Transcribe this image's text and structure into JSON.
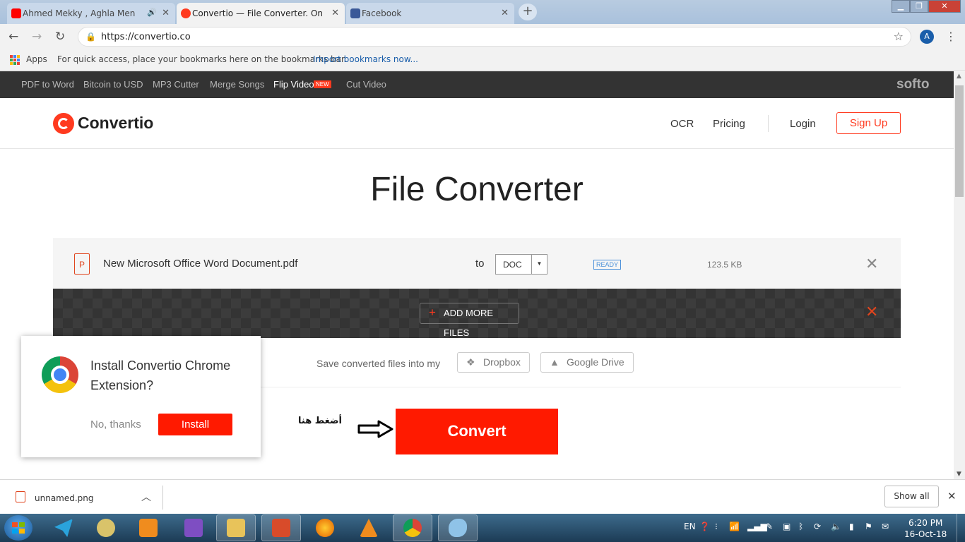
{
  "browser": {
    "tabs": [
      {
        "title": "Ahmed Mekky , Aghla Men A",
        "favicon": "youtube-icon",
        "color": "#ff0000",
        "audio": true,
        "active": false
      },
      {
        "title": "Convertio — File Converter. Onli",
        "favicon": "convertio-icon",
        "color": "#ff3a1f",
        "audio": false,
        "active": true
      },
      {
        "title": "Facebook",
        "favicon": "facebook-icon",
        "color": "#3b5998",
        "audio": false,
        "active": false
      }
    ],
    "url": "https://convertio.co",
    "avatar_letter": "A",
    "bookmarks": {
      "apps_label": "Apps",
      "hint": "For quick access, place your bookmarks here on the bookmarks bar.",
      "import_link": "Import bookmarks now..."
    }
  },
  "softo_bar": {
    "links": [
      "PDF to Word",
      "Bitcoin to USD",
      "MP3 Cutter",
      "Merge Songs",
      "Flip Video",
      "Cut Video"
    ],
    "new_badge": "NEW",
    "brand": "softo"
  },
  "header": {
    "logo_text": "Convertio",
    "nav": {
      "ocr": "OCR",
      "pricing": "Pricing",
      "login": "Login",
      "signup": "Sign Up"
    }
  },
  "main": {
    "title": "File Converter",
    "file": {
      "name": "New Microsoft Office Word Document.pdf",
      "type_letter": "P",
      "to_label": "to",
      "target_format": "DOC",
      "status": "READY",
      "size": "123.5 KB"
    },
    "add_more": "ADD MORE FILES",
    "save_label": "Save converted files into my",
    "services": [
      "Dropbox",
      "Google Drive"
    ],
    "convert": "Convert",
    "arabic_hint": "أضغط هنا"
  },
  "extension_popup": {
    "message": "Install Convertio Chrome Extension?",
    "no_thanks": "No, thanks",
    "install": "Install"
  },
  "downloads": {
    "file": "unnamed.png",
    "show_all": "Show all"
  },
  "taskbar": {
    "lang": "EN",
    "time": "6:20 PM",
    "date": "16-Oct-18"
  },
  "colors": {
    "accent": "#ff3a1f",
    "convert_button": "#ff1a00",
    "ready_badge": "#4a90d9"
  }
}
